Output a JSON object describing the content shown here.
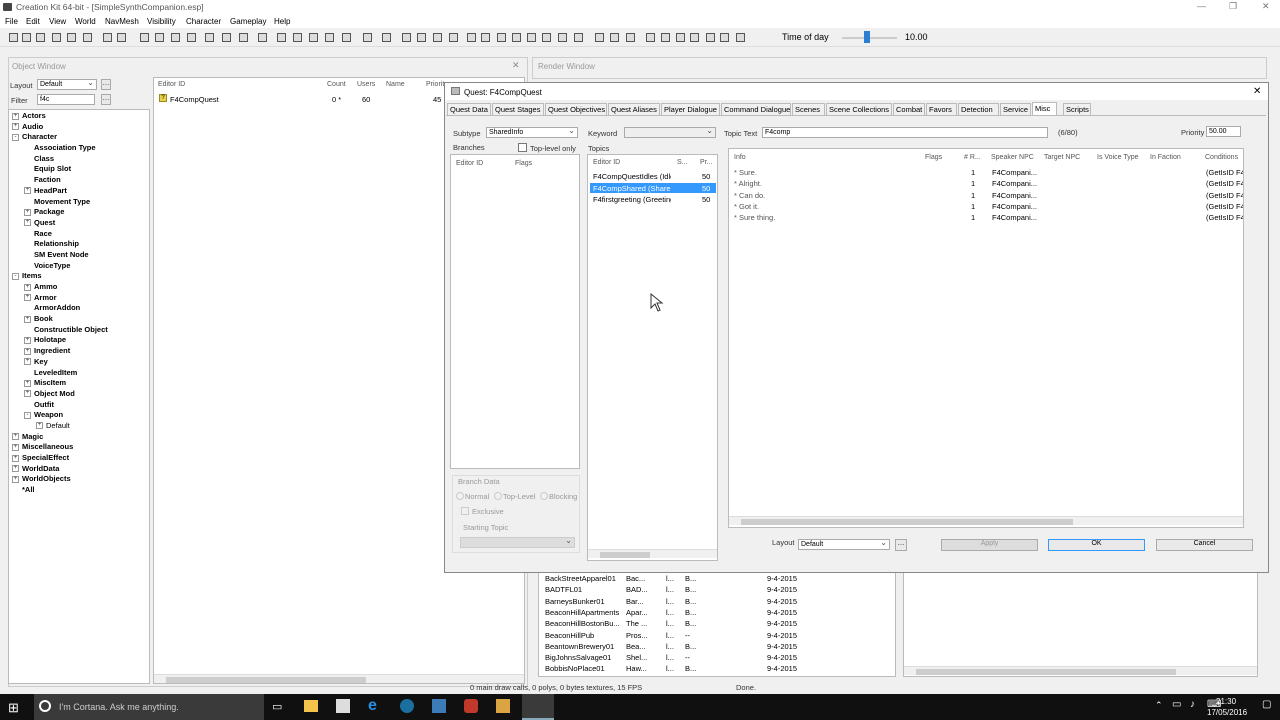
{
  "app": {
    "title": "Creation Kit 64-bit - [SimpleSynthCompanion.esp]"
  },
  "menu": [
    "File",
    "Edit",
    "View",
    "World",
    "NavMesh",
    "Visibility",
    "Character",
    "Gameplay",
    "Help"
  ],
  "toolbar": {
    "time_label": "Time of day",
    "time_value": "10.00",
    "time_fraction": 0.45
  },
  "object_window": {
    "title": "Object Window",
    "layout_label": "Layout",
    "layout_value": "Default",
    "filter_label": "Filter",
    "filter_value": "f4c",
    "columns": [
      "Editor ID",
      "Count",
      "Users",
      "Name",
      "Priorit"
    ],
    "row": {
      "editor_id": "F4CompQuest",
      "count": "0 *",
      "users": "60",
      "priority": "45"
    },
    "tree": [
      {
        "label": "Actors",
        "level": 0,
        "exp": "+"
      },
      {
        "label": "Audio",
        "level": 0,
        "exp": "+"
      },
      {
        "label": "Character",
        "level": 0,
        "exp": "-"
      },
      {
        "label": "Association Type",
        "level": 1
      },
      {
        "label": "Class",
        "level": 1
      },
      {
        "label": "Equip Slot",
        "level": 1
      },
      {
        "label": "Faction",
        "level": 1
      },
      {
        "label": "HeadPart",
        "level": 1,
        "exp": "+"
      },
      {
        "label": "Movement Type",
        "level": 1
      },
      {
        "label": "Package",
        "level": 1,
        "exp": "+"
      },
      {
        "label": "Quest",
        "level": 1,
        "exp": "+"
      },
      {
        "label": "Race",
        "level": 1
      },
      {
        "label": "Relationship",
        "level": 1
      },
      {
        "label": "SM Event Node",
        "level": 1
      },
      {
        "label": "VoiceType",
        "level": 1
      },
      {
        "label": "Items",
        "level": 0,
        "exp": "-"
      },
      {
        "label": "Ammo",
        "level": 1,
        "exp": "+"
      },
      {
        "label": "Armor",
        "level": 1,
        "exp": "+"
      },
      {
        "label": "ArmorAddon",
        "level": 1
      },
      {
        "label": "Book",
        "level": 1,
        "exp": "+"
      },
      {
        "label": "Constructible Object",
        "level": 1
      },
      {
        "label": "Holotape",
        "level": 1,
        "exp": "+"
      },
      {
        "label": "Ingredient",
        "level": 1,
        "exp": "+"
      },
      {
        "label": "Key",
        "level": 1,
        "exp": "+"
      },
      {
        "label": "LeveledItem",
        "level": 1
      },
      {
        "label": "MiscItem",
        "level": 1,
        "exp": "+"
      },
      {
        "label": "Object Mod",
        "level": 1,
        "exp": "+"
      },
      {
        "label": "Outfit",
        "level": 1
      },
      {
        "label": "Weapon",
        "level": 1,
        "exp": "-"
      },
      {
        "label": "Default",
        "level": 2,
        "exp": "+"
      },
      {
        "label": "Magic",
        "level": 0,
        "exp": "+"
      },
      {
        "label": "Miscellaneous",
        "level": 0,
        "exp": "+"
      },
      {
        "label": "SpecialEffect",
        "level": 0,
        "exp": "+"
      },
      {
        "label": "WorldData",
        "level": 0,
        "exp": "+"
      },
      {
        "label": "WorldObjects",
        "level": 0,
        "exp": "+"
      },
      {
        "label": "*All",
        "level": 0
      }
    ]
  },
  "render_window": {
    "title": "Render Window"
  },
  "cell_list": {
    "rows": [
      {
        "id": "BackStreetApparel01",
        "name": "Bac...",
        "c3": "l...",
        "c4": "B...",
        "date": "9-4-2015"
      },
      {
        "id": "BADTFL01",
        "name": "BAD...",
        "c3": "l...",
        "c4": "B...",
        "date": "9-4-2015"
      },
      {
        "id": "BarneysBunker01",
        "name": "Bar...",
        "c3": "l...",
        "c4": "B...",
        "date": "9-4-2015"
      },
      {
        "id": "BeaconHillApartments",
        "name": "Apar...",
        "c3": "l...",
        "c4": "B...",
        "date": "9-4-2015"
      },
      {
        "id": "BeaconHillBostonBu...",
        "name": "The ...",
        "c3": "l...",
        "c4": "B...",
        "date": "9-4-2015"
      },
      {
        "id": "BeaconHillPub",
        "name": "Pros...",
        "c3": "l...",
        "c4": "--",
        "date": "9-4-2015"
      },
      {
        "id": "BeantownBrewery01",
        "name": "Bea...",
        "c3": "l...",
        "c4": "B...",
        "date": "9-4-2015"
      },
      {
        "id": "BigJohnsSalvage01",
        "name": "Shel...",
        "c3": "l...",
        "c4": "--",
        "date": "9-4-2015"
      },
      {
        "id": "BobbisNoPlace01",
        "name": "Haw...",
        "c3": "l...",
        "c4": "B...",
        "date": "9-4-2015"
      }
    ],
    "status_left": "0 main draw calls, 0 polys, 0 bytes textures, 15 FPS",
    "status_right": "Done."
  },
  "quest": {
    "title": "Quest: F4CompQuest",
    "tabs": [
      "Quest Data",
      "Quest Stages",
      "Quest Objectives",
      "Quest Aliases",
      "Player Dialogue",
      "Command Dialogue",
      "Scenes",
      "Scene Collections",
      "Combat",
      "Favors",
      "Detection",
      "Service",
      "Misc",
      "Scripts"
    ],
    "subtype_label": "Subtype",
    "subtype_value": "SharedInfo",
    "keyword_label": "Keyword",
    "topic_text_label": "Topic Text",
    "topic_text_value": "F4comp",
    "topic_count": "(6/80)",
    "priority_label": "Priority",
    "priority_value": "50.00",
    "branches_label": "Branches",
    "top_level_only": "Top-level only",
    "topics_label": "Topics",
    "branch_cols": [
      "Editor ID",
      "Flags"
    ],
    "topic_cols": [
      "Editor ID",
      "S...",
      "Pr..."
    ],
    "topics": [
      {
        "id": "F4CompQuestIdles (Idle)",
        "pr": "50",
        "selected": false
      },
      {
        "id": "F4CompShared (Share...",
        "pr": "50",
        "selected": true
      },
      {
        "id": "F4firstgreeting (Greeting)",
        "pr": "50",
        "selected": false
      }
    ],
    "info_cols": [
      "Info",
      "Flags",
      "# R...",
      "Speaker NPC",
      "Target NPC",
      "Is Voice Type",
      "In Faction",
      "Conditions"
    ],
    "infos": [
      {
        "info": "* Sure.",
        "r": "1",
        "speaker": "F4Compani...",
        "cond": "(GetIsID F4"
      },
      {
        "info": "* Alright.",
        "r": "1",
        "speaker": "F4Compani...",
        "cond": "(GetIsID F4"
      },
      {
        "info": "* Can do.",
        "r": "1",
        "speaker": "F4Compani...",
        "cond": "(GetIsID F4"
      },
      {
        "info": "* Got it.",
        "r": "1",
        "speaker": "F4Compani...",
        "cond": "(GetIsID F4"
      },
      {
        "info": "* Sure thing.",
        "r": "1",
        "speaker": "F4Compani...",
        "cond": "(GetIsID F4"
      }
    ],
    "branch_data_label": "Branch Data",
    "normal": "Normal",
    "top_level": "Top-Level",
    "blocking": "Blocking",
    "exclusive": "Exclusive",
    "starting_topic": "Starting Topic",
    "layout_label": "Layout",
    "layout_value": "Default",
    "apply": "Apply",
    "ok": "OK",
    "cancel": "Cancel"
  },
  "taskbar": {
    "cortana": "I'm Cortana. Ask me anything.",
    "time": "21:30",
    "date": "17/05/2016"
  }
}
